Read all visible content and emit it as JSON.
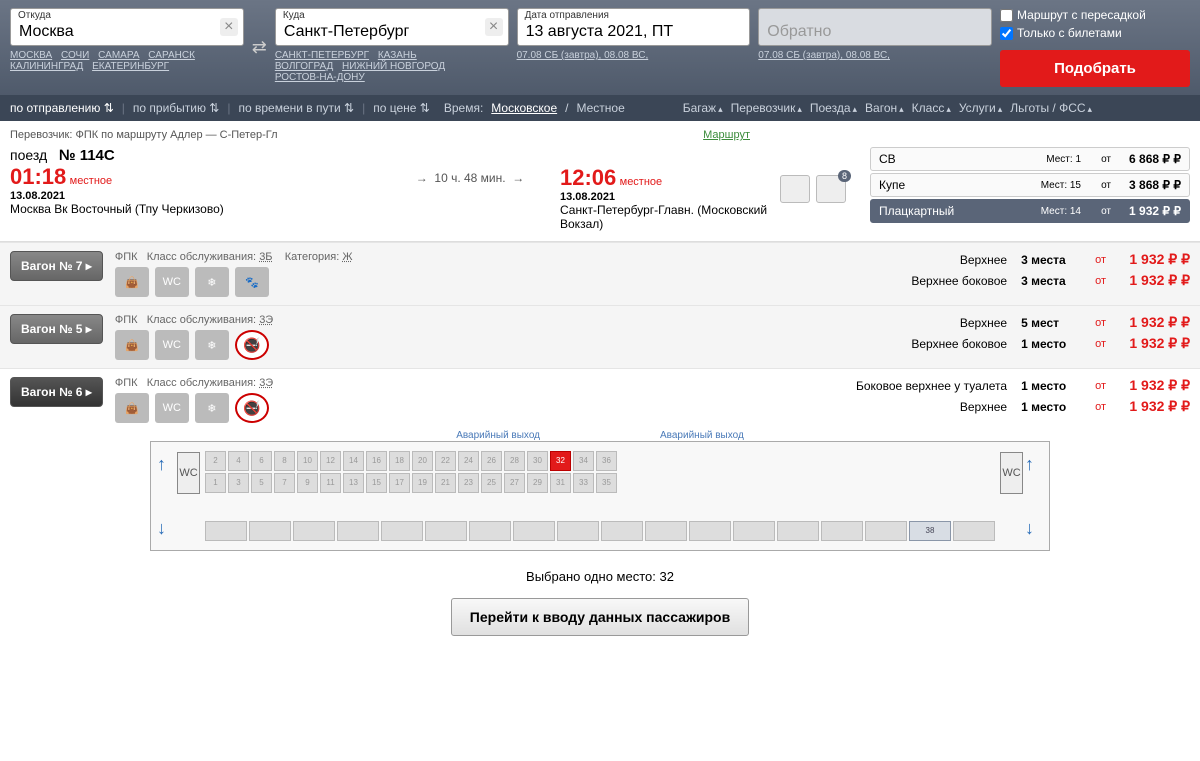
{
  "search": {
    "from_label": "Откуда",
    "from_value": "Москва",
    "to_label": "Куда",
    "to_value": "Санкт-Петербург",
    "date_label": "Дата отправления",
    "date_value": "13 августа 2021, ПТ",
    "return_placeholder": "Обратно",
    "from_cities": [
      "МОСКВА",
      "СОЧИ",
      "САМАРА",
      "САРАНСК",
      "КАЛИНИНГРАД",
      "ЕКАТЕРИНБУРГ"
    ],
    "to_cities": [
      "САНКТ-ПЕТЕРБУРГ",
      "КАЗАНЬ",
      "ВОЛГОГРАД",
      "НИЖНИЙ НОВГОРОД",
      "РОСТОВ-НА-ДОНУ"
    ],
    "date_links": "07.08 СБ (завтра), 08.08 ВС,",
    "return_links": "07.08 СБ (завтра), 08.08 ВС,",
    "opt_transfer": "Маршрут с пересадкой",
    "opt_tickets": "Только с билетами",
    "submit": "Подобрать"
  },
  "filters": {
    "sort_dep": "по отправлению",
    "sort_arr": "по прибытию",
    "sort_dur": "по времени в пути",
    "sort_price": "по цене",
    "time_label": "Время:",
    "time_msk": "Московское",
    "time_local": "Местное",
    "baggage": "Багаж",
    "carrier": "Перевозчик",
    "trains": "Поезда",
    "wagon": "Вагон",
    "class": "Класс",
    "services": "Услуги",
    "benefits": "Льготы / ФСС"
  },
  "result": {
    "carrier_line": "Перевозчик: ФПК   по маршруту Адлер — С-Петер-Гл",
    "route_link": "Маршрут",
    "train_label": "поезд",
    "train_no": "№ 114С",
    "dep_time": "01:18",
    "local": "местное",
    "dep_date": "13.08.2021",
    "dep_station": "Москва Вк Восточный (Тпу Черкизово)",
    "duration": "10 ч. 48 мин.",
    "arr_time": "12:06",
    "arr_date": "13.08.2021",
    "arr_station": "Санкт-Петербург-Главн. (Московский Вокзал)",
    "badge": "8",
    "classes": [
      {
        "name": "СВ",
        "seats": "Мест: 1",
        "ot": "от",
        "price": "6 868"
      },
      {
        "name": "Купе",
        "seats": "Мест: 15",
        "ot": "от",
        "price": "3 868"
      },
      {
        "name": "Плацкартный",
        "seats": "Мест: 14",
        "ot": "от",
        "price": "1 932"
      }
    ]
  },
  "wagons": [
    {
      "btn": "Вагон  № 7  ▸",
      "dark": false,
      "carrier": "ФПК",
      "svc_label": "Класс обслуживания:",
      "svc": "3Б",
      "cat_label": "Категория:",
      "cat": "Ж",
      "amen": [
        "bag",
        "WC",
        "snow",
        "paw"
      ],
      "no_smoke": false,
      "avail": [
        {
          "lbl": "Верхнее",
          "cnt": "3 места",
          "ot": "от",
          "pr": "1 932"
        },
        {
          "lbl": "Верхнее боковое",
          "cnt": "3 места",
          "ot": "от",
          "pr": "1 932"
        }
      ]
    },
    {
      "btn": "Вагон  № 5  ▸",
      "dark": false,
      "carrier": "ФПК",
      "svc_label": "Класс обслуживания:",
      "svc": "3Э",
      "cat_label": "",
      "cat": "",
      "amen": [
        "bag",
        "WC",
        "snow"
      ],
      "no_smoke": true,
      "avail": [
        {
          "lbl": "Верхнее",
          "cnt": "5 мест",
          "ot": "от",
          "pr": "1 932"
        },
        {
          "lbl": "Верхнее боковое",
          "cnt": "1 место",
          "ot": "от",
          "pr": "1 932"
        }
      ]
    },
    {
      "btn": "Вагон  № 6  ▸",
      "dark": true,
      "carrier": "ФПК",
      "svc_label": "Класс обслуживания:",
      "svc": "3Э",
      "cat_label": "",
      "cat": "",
      "amen": [
        "bag",
        "WC",
        "snow"
      ],
      "no_smoke": true,
      "avail": [
        {
          "lbl": "Боковое верхнее у туалета",
          "cnt": "1 место",
          "ot": "от",
          "pr": "1 932"
        },
        {
          "lbl": "Верхнее",
          "cnt": "1 место",
          "ot": "от",
          "pr": "1 932"
        }
      ]
    }
  ],
  "scheme": {
    "exit_label": "Аварийный выход",
    "wc": "WC",
    "selected_seat": "32",
    "available_lower": "38",
    "selected_text": "Выбрано одно место: 32",
    "proceed": "Перейти к вводу данных пассажиров"
  }
}
